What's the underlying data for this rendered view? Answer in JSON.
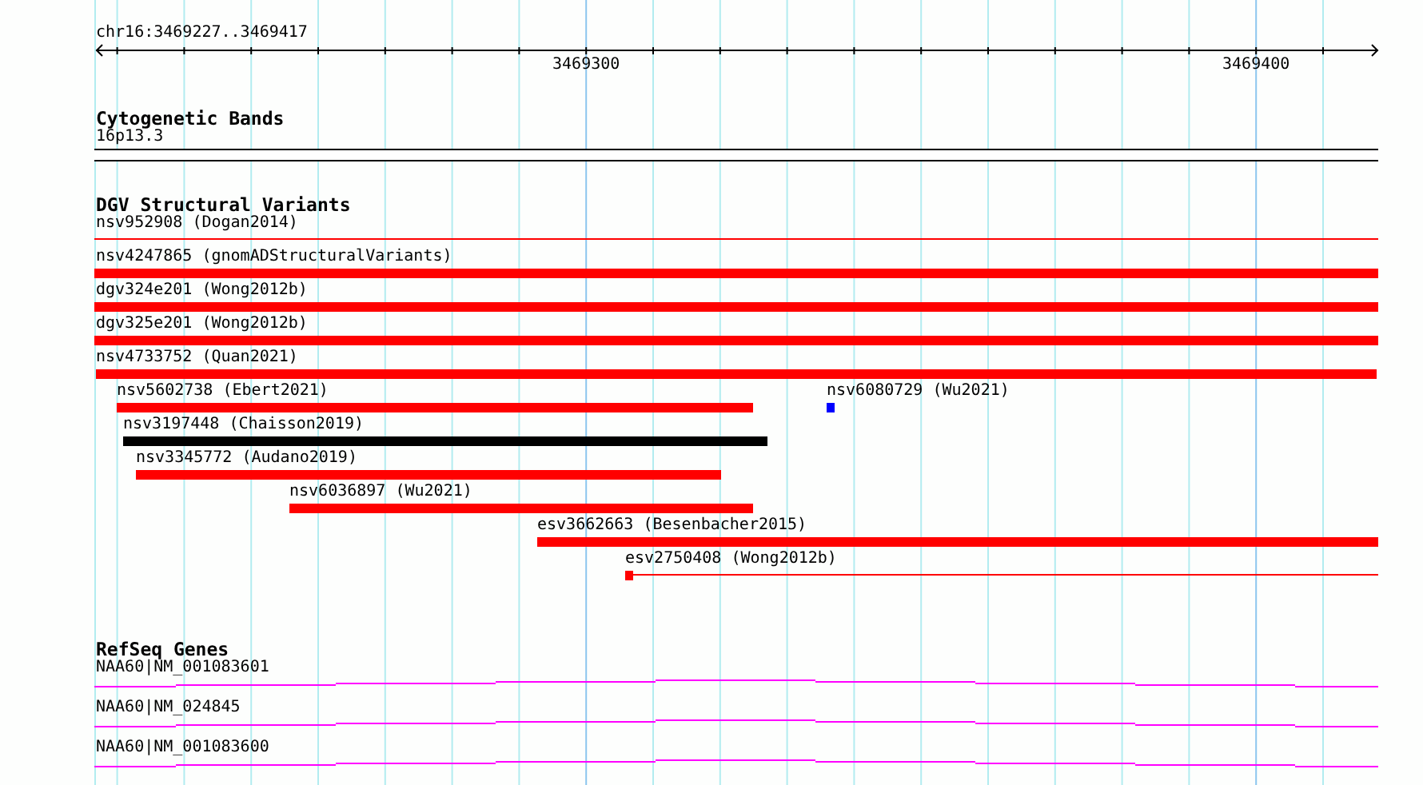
{
  "location": "chr16:3469227..3469417",
  "ruler": {
    "labels": [
      "3469300",
      "3469400"
    ]
  },
  "tracks": [
    {
      "title": "Cytogenetic Bands",
      "kind": "bands",
      "features": [
        {
          "label": "16p13.3"
        }
      ]
    },
    {
      "title": "DGV Structural Variants",
      "kind": "variants",
      "features": [
        {
          "label": "nsv952908 (Dogan2014)",
          "kind": "thin",
          "color": "#ff0000"
        },
        {
          "label": "nsv4247865 (gnomADStructuralVariants)",
          "kind": "bar",
          "color": "#ff0000"
        },
        {
          "label": "dgv324e201 (Wong2012b)",
          "kind": "bar",
          "color": "#ff0000"
        },
        {
          "label": "dgv325e201 (Wong2012b)",
          "kind": "bar",
          "color": "#ff0000"
        },
        {
          "label": "nsv4733752 (Quan2021)",
          "kind": "bar",
          "color": "#ff0000"
        },
        {
          "label": "nsv5602738 (Ebert2021)",
          "kind": "bar",
          "color": "#ff0000"
        },
        {
          "label": "nsv6080729 (Wu2021)",
          "kind": "bar",
          "color": "#0000ff"
        },
        {
          "label": "nsv3197448 (Chaisson2019)",
          "kind": "bar",
          "color": "#000000"
        },
        {
          "label": "nsv3345772 (Audano2019)",
          "kind": "bar",
          "color": "#ff0000"
        },
        {
          "label": "nsv6036897 (Wu2021)",
          "kind": "bar",
          "color": "#ff0000"
        },
        {
          "label": "esv3662663 (Besenbacher2015)",
          "kind": "bar",
          "color": "#ff0000"
        },
        {
          "label": "esv2750408 (Wong2012b)",
          "kind": "dot-thin",
          "color": "#ff0000"
        }
      ]
    },
    {
      "title": "RefSeq Genes",
      "kind": "genes",
      "features": [
        {
          "label": "NAA60|NM_001083601"
        },
        {
          "label": "NAA60|NM_024845"
        },
        {
          "label": "NAA60|NM_001083600"
        }
      ]
    }
  ]
}
